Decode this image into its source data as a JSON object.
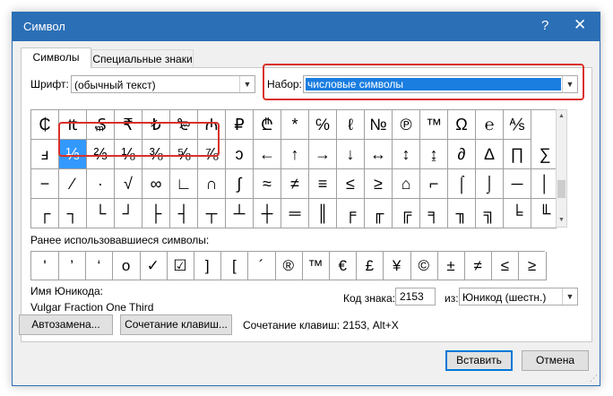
{
  "window": {
    "title": "Символ",
    "help_glyph": "?",
    "close_glyph": "✕"
  },
  "tabs": [
    {
      "label": "Символы",
      "active": true
    },
    {
      "label": "Специальные знаки",
      "active": false
    }
  ],
  "font": {
    "label": "Шрифт:",
    "value": "(обычный текст)"
  },
  "subset": {
    "label": "Набор:",
    "value": "числовые символы"
  },
  "grid_rows": [
    [
      "₵",
      "₶",
      "₷",
      "₹",
      "₺",
      "₻",
      "₼",
      "₽",
      "₾",
      "*",
      "℅",
      "ℓ",
      "№",
      "℗",
      "™",
      "Ω",
      "℮",
      "⅍"
    ],
    [
      "ⅎ",
      "⅓",
      "⅔",
      "⅛",
      "⅜",
      "⅝",
      "⅞",
      "ↄ",
      "←",
      "↑",
      "→",
      "↓",
      "↔",
      "↕",
      "↨",
      "∂",
      "∆",
      "∏",
      "∑"
    ],
    [
      "−",
      "∕",
      "∙",
      "√",
      "∞",
      "∟",
      "∩",
      "∫",
      "≈",
      "≠",
      "≡",
      "≤",
      "≥",
      "⌂",
      "⌐",
      "⌠",
      "⌡",
      "─",
      "│"
    ],
    [
      "┌",
      "┐",
      "└",
      "┘",
      "├",
      "┤",
      "┬",
      "┴",
      "┼",
      "═",
      "║",
      "╒",
      "╓",
      "╔",
      "╕",
      "╖",
      "╗",
      "╘",
      "╙"
    ]
  ],
  "selected_symbol": "⅓",
  "recent": {
    "label": "Ранее использовавшиеся символы:",
    "symbols": [
      "'",
      "’",
      "‘",
      "o",
      "✓",
      "☑",
      "]",
      "[",
      "´",
      "®",
      "™",
      "€",
      "£",
      "¥",
      "©",
      "±",
      "≠",
      "≤",
      "≥"
    ]
  },
  "unicode_name": {
    "label": "Имя Юникода:",
    "value": "Vulgar Fraction One Third"
  },
  "char_code": {
    "label": "Код знака:",
    "value": "2153"
  },
  "from": {
    "label": "из:",
    "value": "Юникод (шестн.)"
  },
  "buttons": {
    "autocorrect": "Автозамена...",
    "shortcut_key": "Сочетание клавиш...",
    "insert": "Вставить",
    "cancel": "Отмена"
  },
  "shortcut_text": "Сочетание клавиш: 2153, Alt+X",
  "highlight_color": "#d9302b",
  "title_bar_color": "#2b6fb6",
  "selection_color": "#3399ff"
}
